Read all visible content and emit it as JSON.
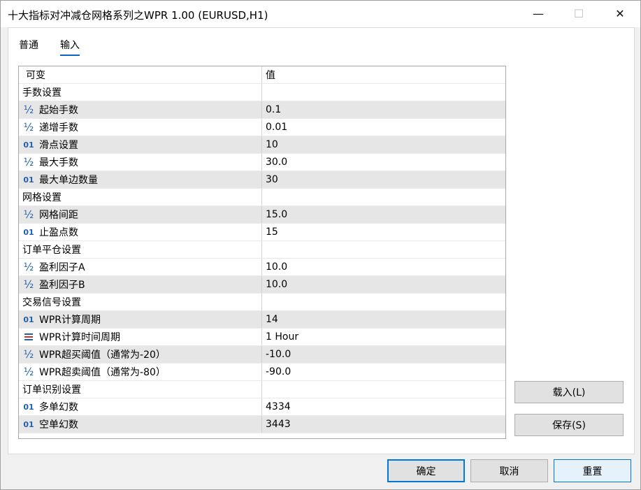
{
  "window": {
    "title": "十大指标对冲减仓网格系列之WPR 1.00 (EURUSD,H1)",
    "controls": {
      "minimize": "—",
      "maximize": "☐",
      "close": "✕"
    }
  },
  "tabs": [
    {
      "label": "普通"
    },
    {
      "label": "输入"
    }
  ],
  "grid": {
    "header": {
      "name": "可变",
      "value": "值"
    },
    "rows": [
      {
        "type": "section",
        "name": "手数设置",
        "value": ""
      },
      {
        "type": "double",
        "icon": "½",
        "name": "起始手数",
        "value": "0.1"
      },
      {
        "type": "double",
        "icon": "½",
        "name": "递增手数",
        "value": "0.01"
      },
      {
        "type": "int",
        "icon": "01",
        "name": "滑点设置",
        "value": "10"
      },
      {
        "type": "double",
        "icon": "½",
        "name": "最大手数",
        "value": "30.0"
      },
      {
        "type": "int",
        "icon": "01",
        "name": "最大单边数量",
        "value": "30"
      },
      {
        "type": "section",
        "name": "网格设置",
        "value": ""
      },
      {
        "type": "double",
        "icon": "½",
        "name": "网格间距",
        "value": "15.0"
      },
      {
        "type": "int",
        "icon": "01",
        "name": "止盈点数",
        "value": "15"
      },
      {
        "type": "section",
        "name": "订单平仓设置",
        "value": ""
      },
      {
        "type": "double",
        "icon": "½",
        "name": "盈利因子A",
        "value": "10.0"
      },
      {
        "type": "double",
        "icon": "½",
        "name": "盈利因子B",
        "value": "10.0"
      },
      {
        "type": "section",
        "name": "交易信号设置",
        "value": ""
      },
      {
        "type": "int",
        "icon": "01",
        "name": "WPR计算周期",
        "value": "14"
      },
      {
        "type": "enum",
        "icon": "enum",
        "name": "WPR计算时间周期",
        "value": "1 Hour"
      },
      {
        "type": "double",
        "icon": "½",
        "name": "WPR超买阈值（通常为-20）",
        "value": "-10.0"
      },
      {
        "type": "double",
        "icon": "½",
        "name": "WPR超卖阈值（通常为-80）",
        "value": "-90.0"
      },
      {
        "type": "section",
        "name": "订单识别设置",
        "value": ""
      },
      {
        "type": "int",
        "icon": "01",
        "name": "多单幻数",
        "value": "4334"
      },
      {
        "type": "int",
        "icon": "01",
        "name": "空单幻数",
        "value": "3443"
      }
    ]
  },
  "side_buttons": {
    "load": "载入(L)",
    "save": "保存(S)"
  },
  "footer_buttons": {
    "ok": "确定",
    "cancel": "取消",
    "reset": "重置"
  },
  "colors": {
    "accent": "#0078d7",
    "row_shade": "#e6e6e6",
    "icon_blue": "#2060b0",
    "enum_red": "#d03030"
  }
}
